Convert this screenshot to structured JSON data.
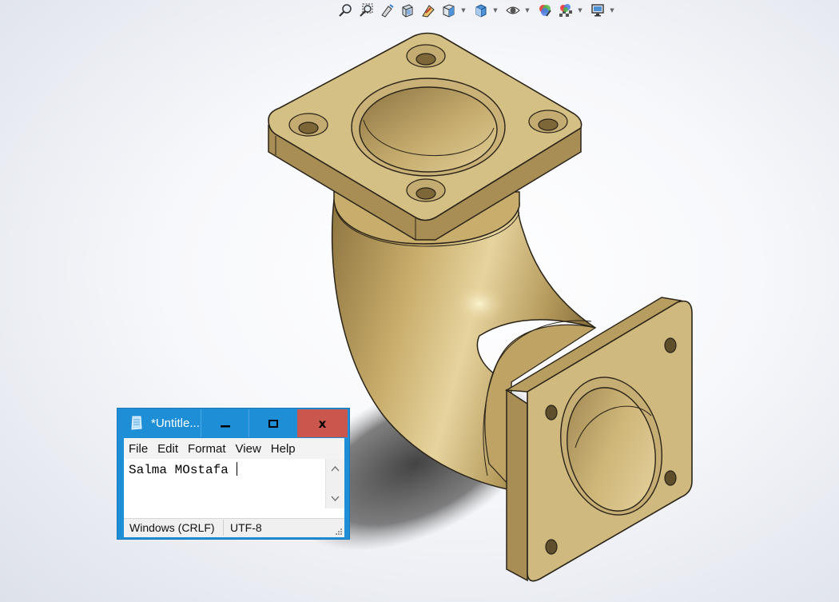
{
  "toolbar": {
    "icons": [
      "zoom-to-fit-icon",
      "zoom-to-area-icon",
      "previous-view-icon",
      "section-view-icon",
      "dynamic-annotation-icon",
      "view-orientation-icon",
      "display-style-icon",
      "hide-show-items-icon",
      "edit-appearance-icon",
      "apply-scene-icon",
      "view-settings-icon"
    ]
  },
  "model": {
    "colors": {
      "brass_light": "#d9c58a",
      "brass_mid": "#c2a869",
      "brass_dark": "#9a814a",
      "edge": "#2a2418"
    }
  },
  "notepad": {
    "title": "*Untitle...",
    "controls": {
      "minimize": "–",
      "maximize": "▢",
      "close": "x"
    },
    "menu": [
      "File",
      "Edit",
      "Format",
      "View",
      "Help"
    ],
    "text": "Salma MOstafa ",
    "status": {
      "line_ending": "Windows (CRLF)",
      "encoding": "UTF-8"
    },
    "colors": {
      "titlebar": "#1e8fd6",
      "close": "#c9574e"
    }
  }
}
